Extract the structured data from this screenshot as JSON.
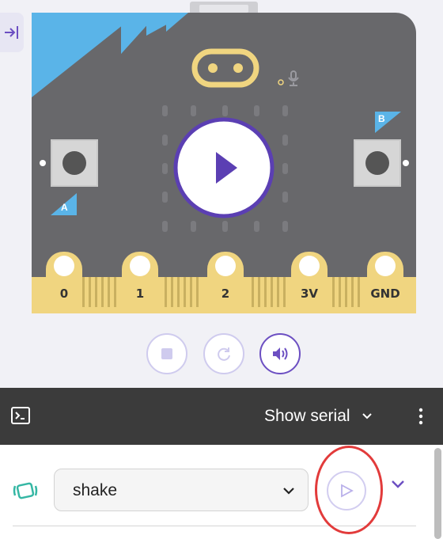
{
  "simulator": {
    "collapse_icon": "collapse-panel-icon",
    "play_icon": "play-icon",
    "button_a_label": "A",
    "button_b_label": "B",
    "pins": [
      "0",
      "1",
      "2",
      "3V",
      "GND"
    ],
    "controls": {
      "stop_icon": "stop-icon",
      "restart_icon": "restart-icon",
      "sound_icon": "speaker-icon"
    },
    "colors": {
      "board": "#68686b",
      "accent_blue": "#5ab4e8",
      "gold": "#f0d580",
      "purple": "#6c4fc2"
    }
  },
  "serial": {
    "terminal_icon": "terminal-icon",
    "toggle_label": "Show serial",
    "chevron_icon": "chevron-down-icon",
    "menu_icon": "more-vertical-icon"
  },
  "actions": {
    "event_icon": "shake-gesture-icon",
    "selected_event": "shake",
    "send_icon": "send-icon",
    "expand_icon": "chevron-down-icon"
  }
}
